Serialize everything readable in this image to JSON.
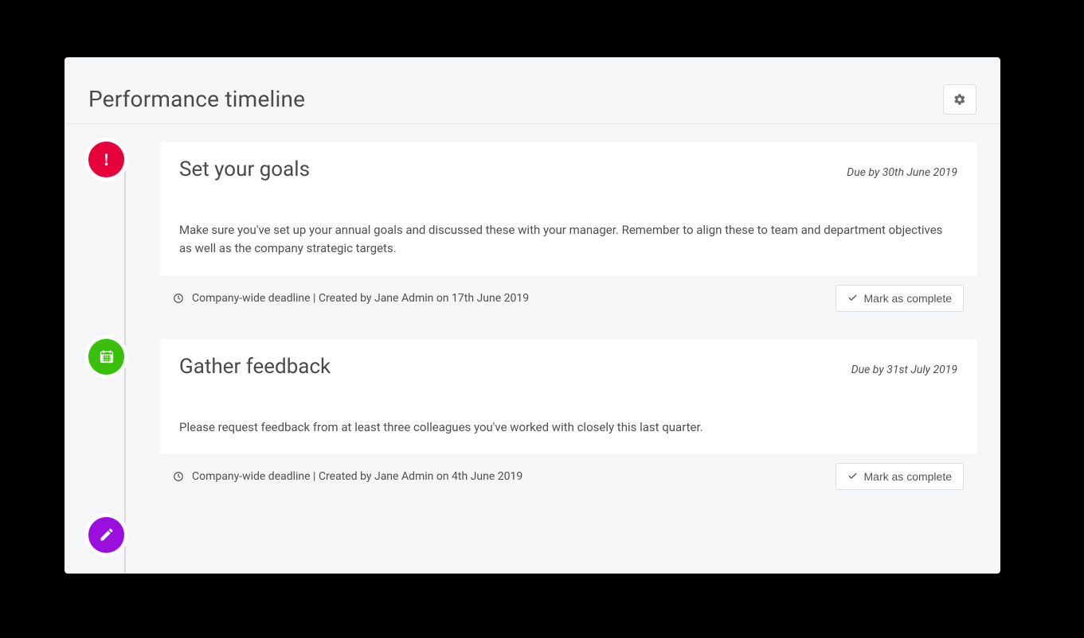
{
  "page_title": "Performance timeline",
  "button_labels": {
    "mark_complete": "Mark as complete"
  },
  "timeline": [
    {
      "badge_color": "red",
      "badge_icon": "exclamation",
      "title": "Set your goals",
      "due": "Due by 30th June 2019",
      "description": "Make sure you've set up your annual goals and discussed these with your manager. Remember to align these to team and department objectives as well as the company strategic targets.",
      "meta": "Company-wide deadline | Created by Jane Admin on 17th June 2019"
    },
    {
      "badge_color": "green",
      "badge_icon": "calendar",
      "title": "Gather feedback",
      "due": "Due by 31st July 2019",
      "description": "Please request feedback from at least three colleagues you've worked with closely this last quarter.",
      "meta": "Company-wide deadline | Created by Jane Admin on 4th June 2019"
    },
    {
      "badge_color": "purple",
      "badge_icon": "pencil"
    }
  ]
}
